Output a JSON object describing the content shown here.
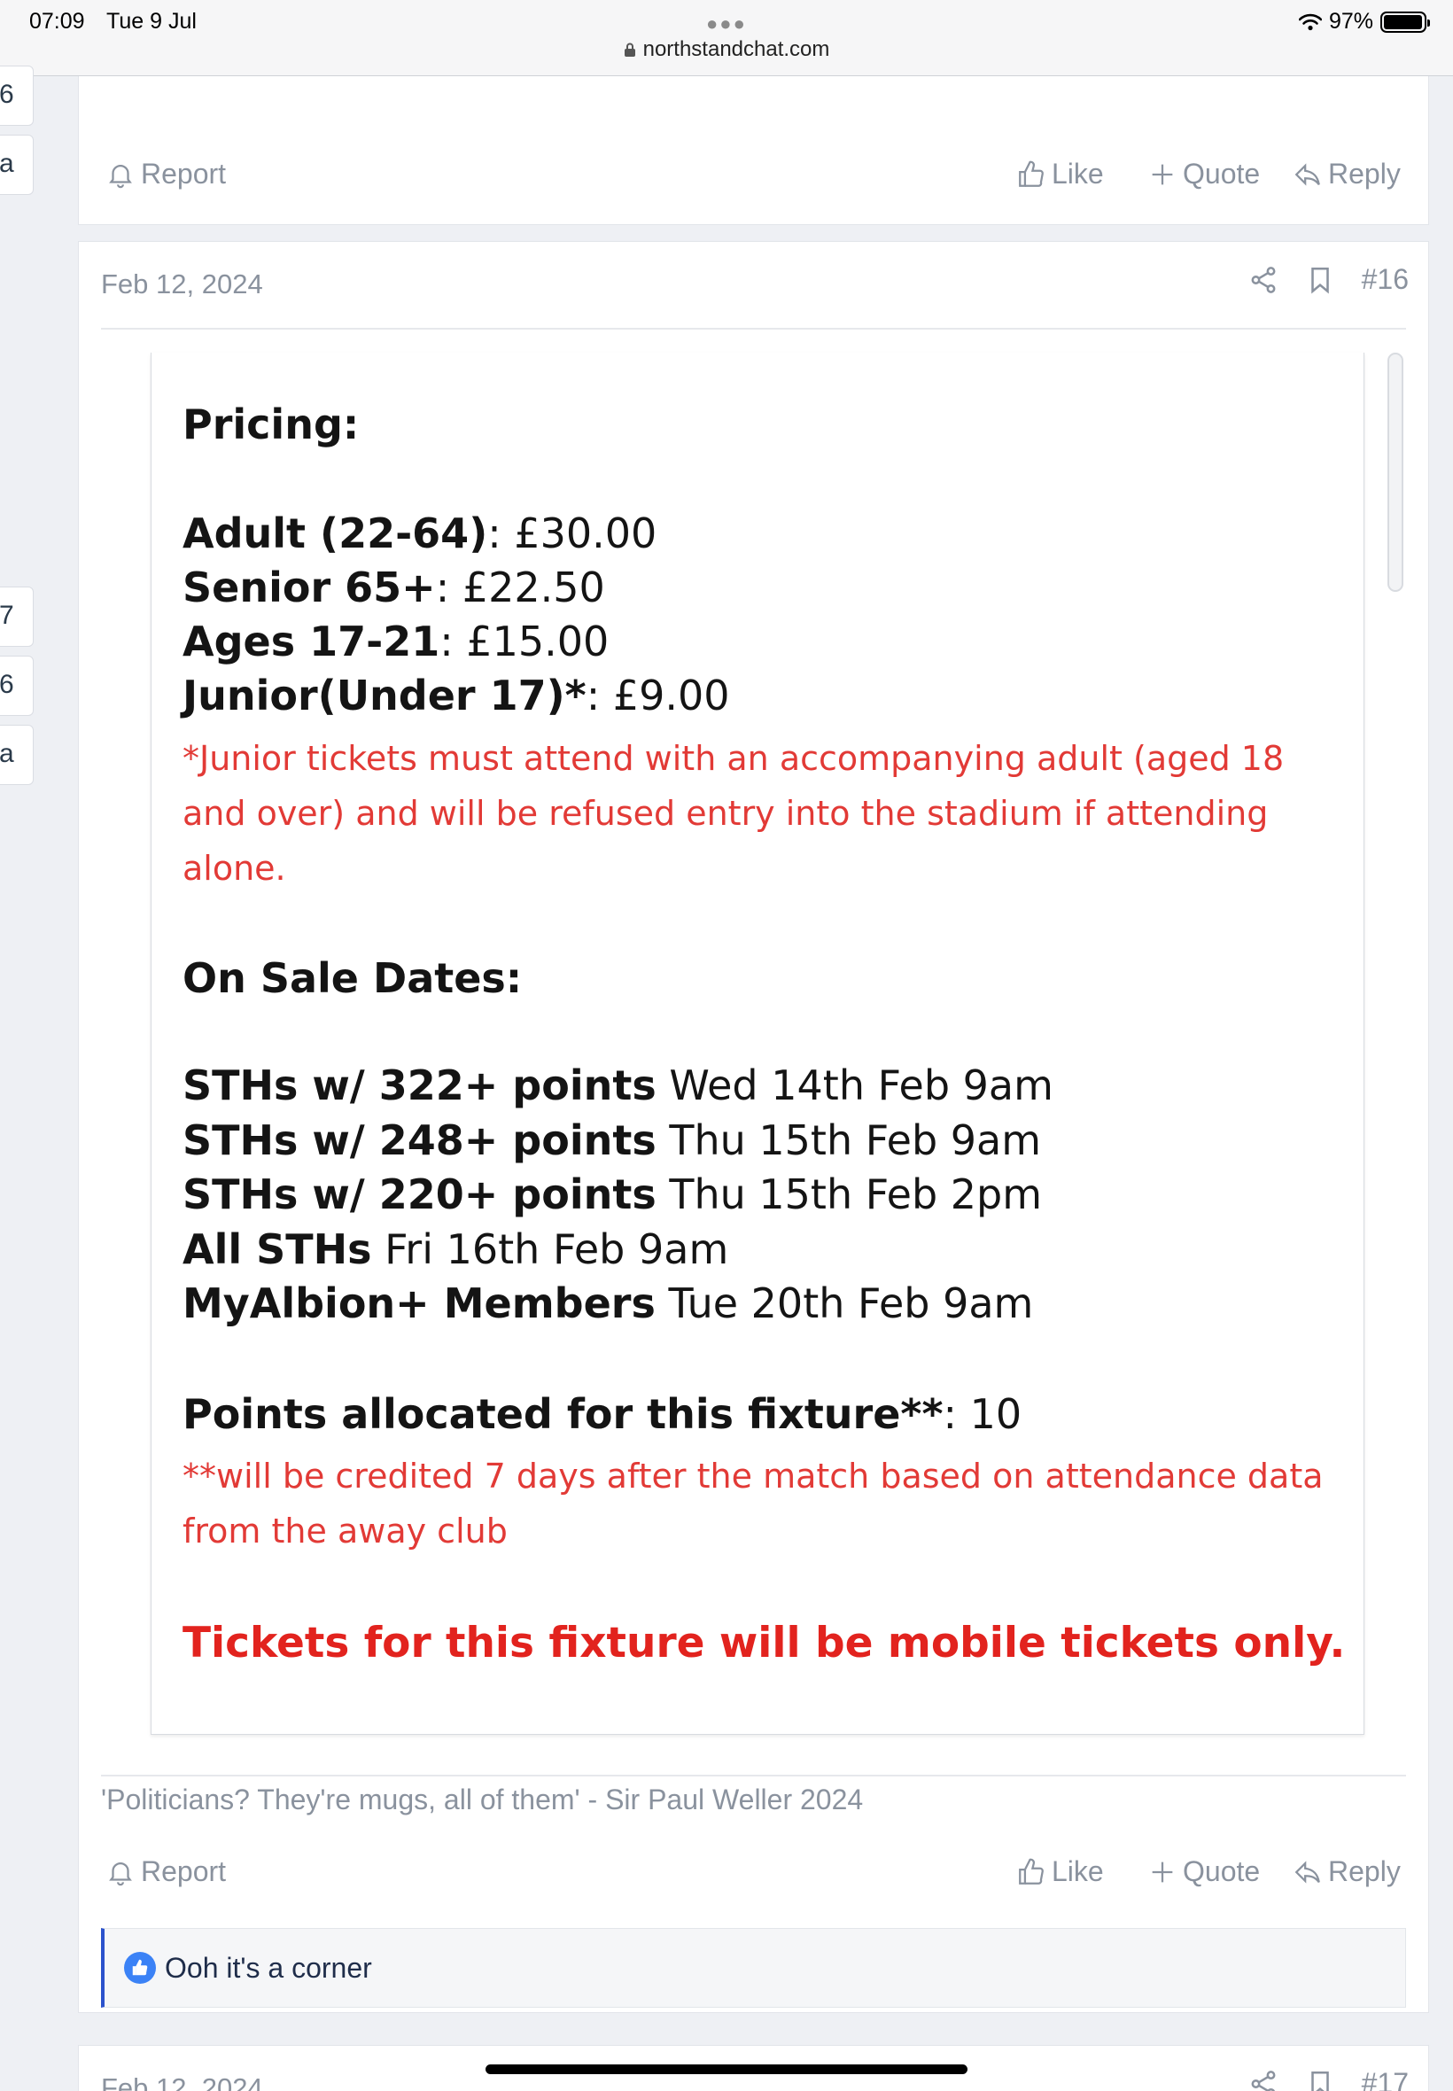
{
  "status_bar": {
    "time": "07:09",
    "date": "Tue 9 Jul",
    "url": "northstandchat.com",
    "battery": "97%",
    "battery_level": 0.97
  },
  "edge_badges": [
    "6",
    "a",
    "7",
    "6",
    "a"
  ],
  "actions": {
    "report": "Report",
    "like": "Like",
    "quote": "Quote",
    "reply": "Reply"
  },
  "post16": {
    "date": "Feb 12, 2024",
    "number": "#16",
    "pricing_title": "Pricing:",
    "prices": [
      {
        "label": "Adult (22-64)",
        "value": ": £30.00"
      },
      {
        "label": "Senior 65+",
        "value": ": £22.50"
      },
      {
        "label": "Ages 17-21",
        "value": ": £15.00"
      },
      {
        "label": "Junior(Under 17)*",
        "value": ": £9.00"
      }
    ],
    "junior_note": "*Junior tickets must attend with an accompanying adult (aged 18 and over) and will be refused entry into the stadium if attending alone.",
    "on_sale_title": "On Sale Dates:",
    "sale_dates": [
      {
        "label": "STHs w/ 322+ points",
        "value": " Wed 14th Feb 9am"
      },
      {
        "label": "STHs w/ 248+ points",
        "value": " Thu 15th Feb 9am"
      },
      {
        "label": "STHs w/ 220+ points",
        "value": " Thu 15th Feb 2pm"
      },
      {
        "label": "All STHs",
        "value": " Fri 16th Feb 9am"
      },
      {
        "label": "MyAlbion+ Members",
        "value": " Tue 20th Feb 9am"
      }
    ],
    "points_label": "Points allocated for this fixture**",
    "points_value": ": 10",
    "points_note": "**will be credited 7 days after the match based on attendance data from the away club",
    "mobile_note": "Tickets for this fixture will be mobile tickets only.",
    "signature": "'Politicians? They're mugs, all of them' - Sir Paul Weller 2024",
    "reaction_text": "Ooh it's a corner"
  },
  "post17": {
    "date": "Feb 12, 2024",
    "number": "#17"
  }
}
